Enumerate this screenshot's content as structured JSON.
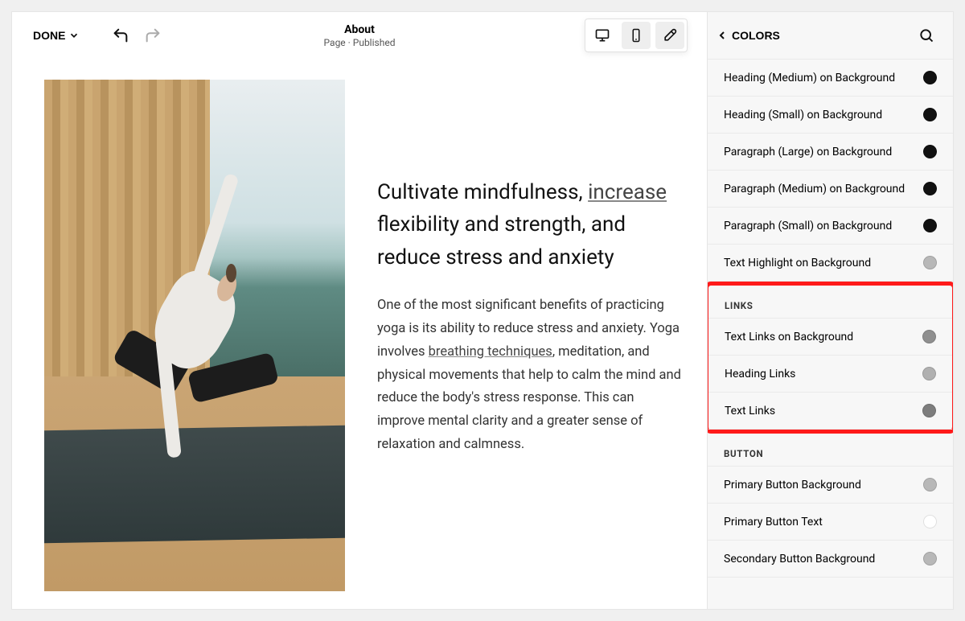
{
  "topbar": {
    "done_label": "DONE",
    "title": "About",
    "subtitle": "Page · Published"
  },
  "content": {
    "headline_pre": "Cultivate mindfulness, ",
    "headline_link": "increase",
    "headline_post": " flexibility and strength, and reduce stress and anxiety",
    "para_pre": "One of the most significant benefits of practicing yoga is its ability to reduce stress and anxiety. Yoga involves ",
    "para_link": "breathing techniques",
    "para_post": ", meditation, and physical movements that help to calm the mind and reduce the body's stress response. This can improve mental clarity and a greater sense of relaxation and calmness."
  },
  "panel": {
    "title": "COLORS",
    "text_items": [
      {
        "label": "Heading (Medium) on Background",
        "swatch": "#111111"
      },
      {
        "label": "Heading (Small) on Background",
        "swatch": "#111111"
      },
      {
        "label": "Paragraph (Large) on Background",
        "swatch": "#111111"
      },
      {
        "label": "Paragraph (Medium) on Background",
        "swatch": "#111111"
      },
      {
        "label": "Paragraph (Small) on Background",
        "swatch": "#111111"
      },
      {
        "label": "Text Highlight on Background",
        "swatch": "#b8b8b8"
      }
    ],
    "links_section_label": "LINKS",
    "links_items": [
      {
        "label": "Text Links on Background",
        "swatch": "#8f8f8f"
      },
      {
        "label": "Heading Links",
        "swatch": "#b0b0b0"
      },
      {
        "label": "Text Links",
        "swatch": "#7d7d7d"
      }
    ],
    "button_section_label": "BUTTON",
    "button_items": [
      {
        "label": "Primary Button Background",
        "swatch": "#b8b8b8"
      },
      {
        "label": "Primary Button Text",
        "swatch": "#ffffff"
      },
      {
        "label": "Secondary Button Background",
        "swatch": "#b8b8b8"
      }
    ]
  }
}
